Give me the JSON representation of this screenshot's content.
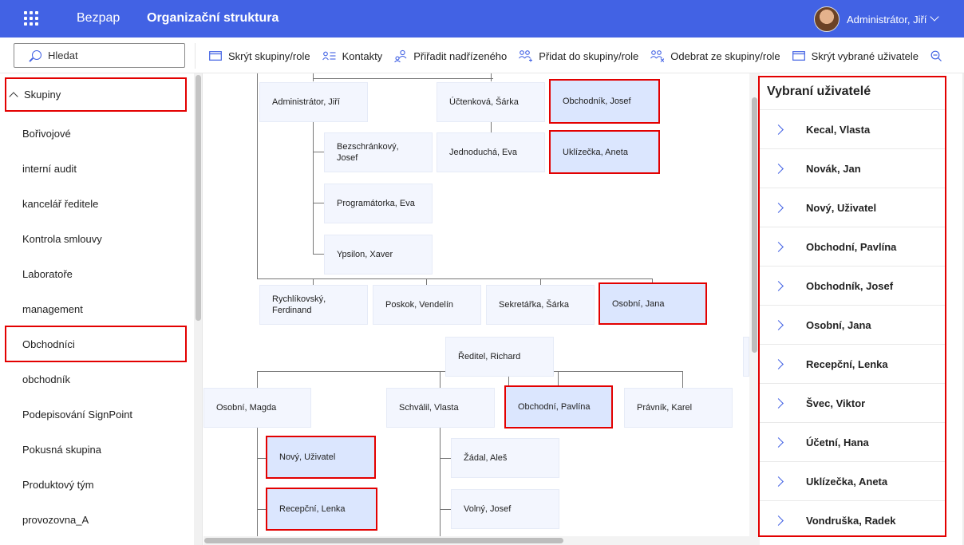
{
  "header": {
    "brand": "Bezpap",
    "title": "Organizační struktura",
    "user_name": "Administrátor, Jiří",
    "accent": "#4262e4"
  },
  "search": {
    "placeholder": "Hledat"
  },
  "toolbar": {
    "hide_groups": "Skrýt skupiny/role",
    "contacts": "Kontakty",
    "assign_superior": "Přiřadit nadřízeného",
    "add_to_group": "Přidat do skupiny/role",
    "remove_from_group": "Odebrat ze skupiny/role",
    "hide_selected": "Skrýt vybrané uživatele"
  },
  "sidebar": {
    "header": "Skupiny",
    "items": [
      "Bořivojové",
      "interní audit",
      "kancelář ředitele",
      "Kontrola smlouvy",
      "Laboratoře",
      "management",
      "Obchodníci",
      "obchodník",
      "Podepisování SignPoint",
      "Pokusná skupina",
      "Produktový tým",
      "provozovna_A"
    ]
  },
  "chart": {
    "nodes": {
      "n01": "Administrátor, Jiří",
      "n02": "Účtenková, Šárka",
      "n03": "Obchodník, Josef",
      "n04": "Bezschránkový, Josef",
      "n05": "Jednoduchá, Eva",
      "n06": "Uklízečka, Aneta",
      "n07": "Programátorka, Eva",
      "n08": "Ypsilon, Xaver",
      "n09": "Rychlíkovský, Ferdinand",
      "n10": "Poskok, Vendelín",
      "n11": "Sekretářka, Šárka",
      "n12": "Osobní, Jana",
      "n13": "Ředitel, Richard",
      "n14": "Osobní, Magda",
      "n15": "Schválil, Vlasta",
      "n16": "Obchodní, Pavlína",
      "n17": "Právník, Karel",
      "n18": "Nový, Uživatel",
      "n19": "Žádal, Aleš",
      "n20": "Recepční, Lenka",
      "n21": "Volný, Josef"
    }
  },
  "right_panel": {
    "title": "Vybraní uživatelé",
    "users": [
      "Kecal, Vlasta",
      "Novák, Jan",
      "Nový, Uživatel",
      "Obchodní, Pavlína",
      "Obchodník, Josef",
      "Osobní, Jana",
      "Recepční, Lenka",
      "Švec, Viktor",
      "Účetní, Hana",
      "Uklízečka, Aneta",
      "Vondruška, Radek"
    ]
  }
}
